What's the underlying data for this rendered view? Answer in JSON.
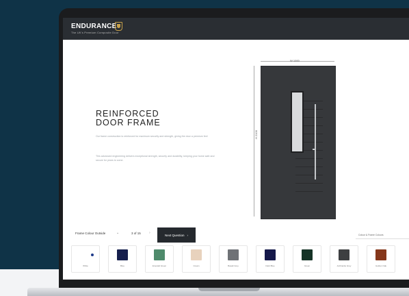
{
  "brand": {
    "name": "ENDURANCE",
    "tagline": "The UK's Premium Composite Door"
  },
  "hero": {
    "heading_line1": "REINFORCED",
    "heading_line2": "DOOR FRAME",
    "paragraph1": "Our frame construction is reinforced for maximum security and strength, giving the door a premium feel",
    "paragraph2": "This advanced engineering delivers exceptional strength, security and durability, keeping your home safe and secure for years to come."
  },
  "door": {
    "color": "#36383b",
    "glass_color": "#d9dbdd",
    "handle_color": "#c5c8cb",
    "width_label": "W 1000",
    "height_label": "H 2100"
  },
  "toolbar": {
    "selector_label": "Frame Colour Outside",
    "step_count": "3 of 15",
    "next_button_label": "Next Question",
    "help_link": "Colour & Frame Colours"
  },
  "swatches": [
    {
      "label": "White",
      "color": "#ffffff",
      "selected": true
    },
    {
      "label": "Blue",
      "color": "#161f4d"
    },
    {
      "label": "Emerald Green",
      "color": "#4f8b6c"
    },
    {
      "label": "Cream",
      "color": "#e8d2bd"
    },
    {
      "label": "Basalt Grey",
      "color": "#6f7276"
    },
    {
      "label": "Dark Blue",
      "color": "#15184a"
    },
    {
      "label": "Green",
      "color": "#153326"
    },
    {
      "label": "Anthracite Grey",
      "color": "#3d3f41"
    },
    {
      "label": "Golden Oak",
      "color": "#85371b"
    }
  ]
}
